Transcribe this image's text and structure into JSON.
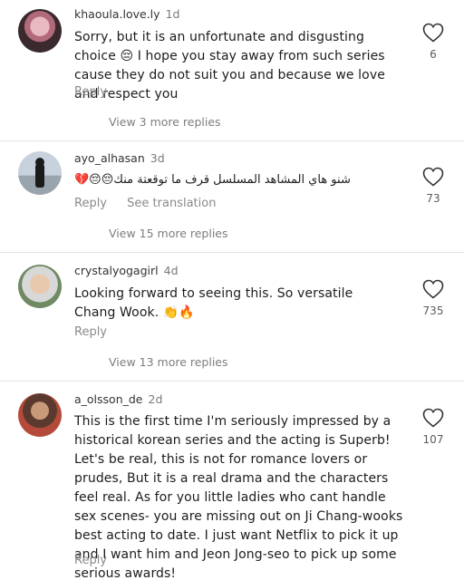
{
  "comments": [
    {
      "username": "khaoula.love.ly",
      "age": "1d",
      "text": "Sorry, but it is an unfortunate and disgusting choice 😔  I hope you stay away from such series cause they do not suit you and because we love and respect you",
      "reply_label": "Reply",
      "likes": "6",
      "view_more": "View 3 more replies"
    },
    {
      "username": "ayo_alhasan",
      "age": "3d",
      "text": "شنو هاي المشاهد المسلسل قرف ما توقعتة منك😔😔💔",
      "reply_label": "Reply",
      "translate_label": "See translation",
      "likes": "73",
      "view_more": "View 15 more replies"
    },
    {
      "username": "crystalyogagirl",
      "age": "4d",
      "text": "Looking forward to seeing this. So versatile Chang Wook. 👏🔥",
      "reply_label": "Reply",
      "likes": "735",
      "view_more": "View 13 more replies"
    },
    {
      "username": "a_olsson_de",
      "age": "2d",
      "text": "This is the first time I'm seriously impressed by a historical korean series and the acting is Superb! Let's be real, this is not for romance lovers or prudes, But it is a real drama and the characters feel real. As for you little ladies who cant handle sex scenes- you are missing out on Ji Chang-wooks best acting to date. I just want Netflix to pick it up and I want him and Jeon Jong-seo to pick up some serious awards!",
      "reply_label": "Reply",
      "likes": "107"
    }
  ],
  "colors": {
    "text": "#1c1c1c",
    "muted": "#8a8a8a",
    "divider": "#e4e4e4"
  },
  "icons": {
    "like": "heart-outline-icon"
  }
}
